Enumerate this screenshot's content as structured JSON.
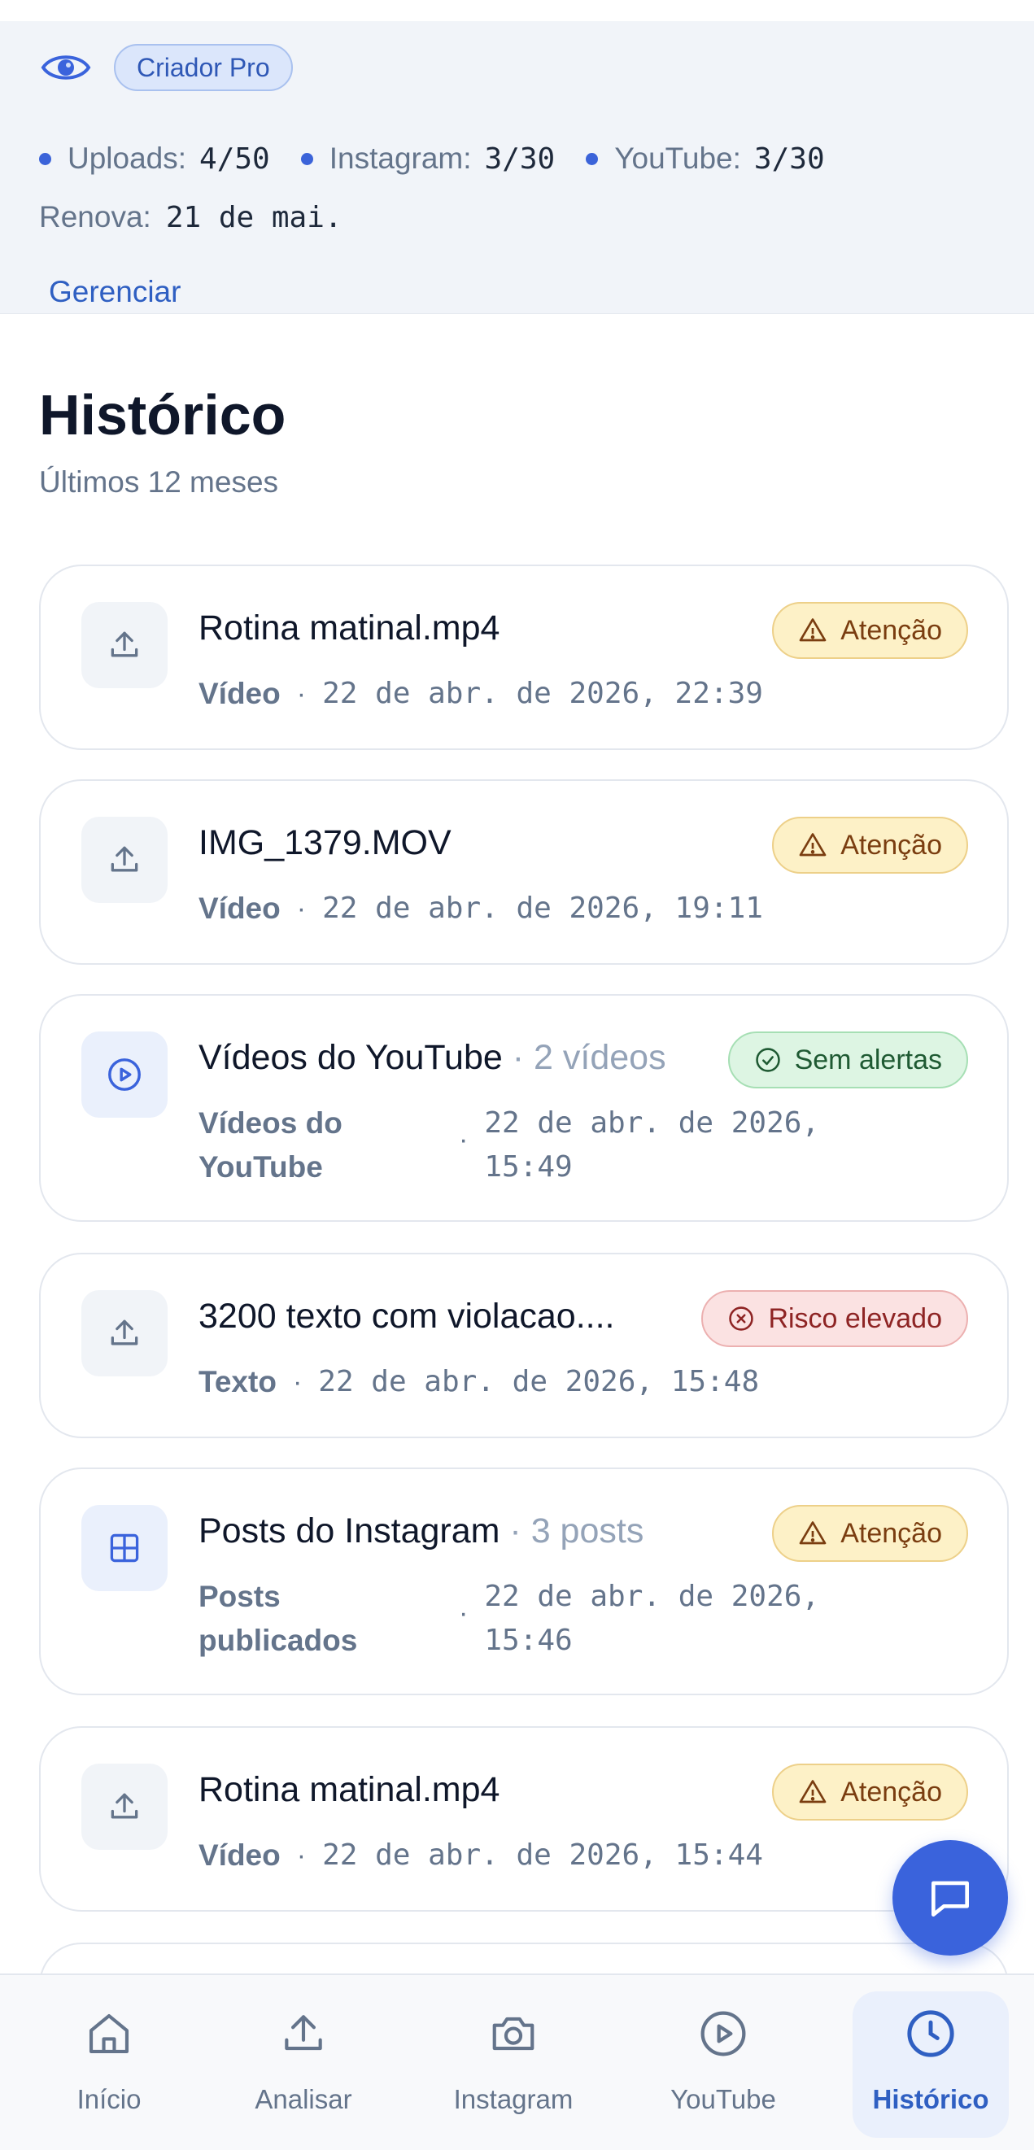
{
  "plan": {
    "badge": "Criador Pro",
    "uploads_label": "Uploads:",
    "uploads_value": "4/50",
    "instagram_label": "Instagram:",
    "instagram_value": "3/30",
    "youtube_label": "YouTube:",
    "youtube_value": "3/30",
    "renew_label": "Renova:",
    "renew_value": "21 de mai.",
    "manage_label": "Gerenciar"
  },
  "history": {
    "title": "Histórico",
    "subtitle": "Últimos 12 meses",
    "items": [
      {
        "icon": "upload-icon",
        "title": "Rotina matinal.mp4",
        "count": "",
        "type": "Vídeo",
        "date": "22 de abr. de 2026, 22:39",
        "badge": "Atenção",
        "status": "warning"
      },
      {
        "icon": "upload-icon",
        "title": "IMG_1379.MOV",
        "count": "",
        "type": "Vídeo",
        "date": "22 de abr. de 2026, 19:11",
        "badge": "Atenção",
        "status": "warning"
      },
      {
        "icon": "play-circle-icon",
        "title": "Vídeos do YouTube",
        "count": "· 2 vídeos",
        "type": "Vídeos do YouTube",
        "date": "22 de abr. de 2026, 15:49",
        "badge": "Sem alertas",
        "status": "ok"
      },
      {
        "icon": "upload-icon",
        "title": "3200 texto com violacao....",
        "count": "",
        "type": "Texto",
        "date": "22 de abr. de 2026, 15:48",
        "badge": "Risco elevado",
        "status": "risk"
      },
      {
        "icon": "grid-icon",
        "title": "Posts do Instagram",
        "count": "· 3 posts",
        "type": "Posts publicados",
        "date": "22 de abr. de 2026, 15:46",
        "badge": "Atenção",
        "status": "warning"
      },
      {
        "icon": "upload-icon",
        "title": "Rotina matinal.mp4",
        "count": "",
        "type": "Vídeo",
        "date": "22 de abr. de 2026, 15:44",
        "badge": "Atenção",
        "status": "warning"
      }
    ]
  },
  "nav": [
    {
      "label": "Início",
      "icon": "home-icon"
    },
    {
      "label": "Analisar",
      "icon": "upload-icon"
    },
    {
      "label": "Instagram",
      "icon": "camera-icon"
    },
    {
      "label": "YouTube",
      "icon": "play-circle-icon"
    },
    {
      "label": "Histórico",
      "icon": "clock-icon",
      "active": true
    }
  ],
  "colors": {
    "accent": "#3a63dc",
    "warning_bg": "#fdf1c7",
    "ok_bg": "#ddf5e3",
    "risk_bg": "#fbe2e2"
  }
}
